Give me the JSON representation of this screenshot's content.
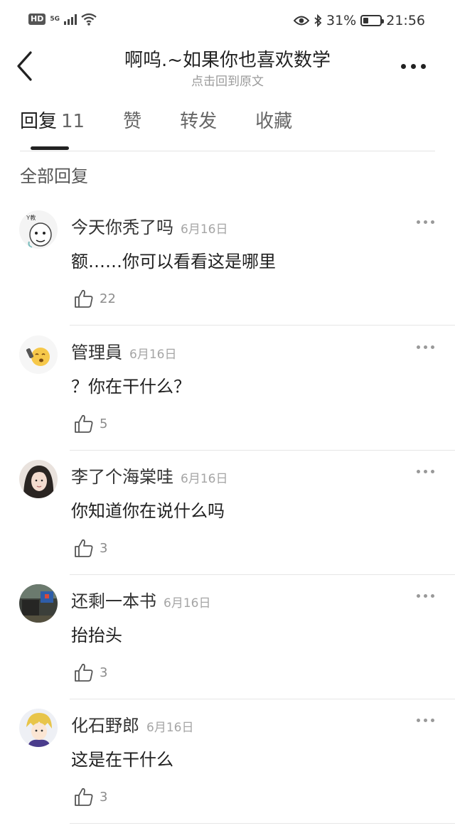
{
  "status_bar": {
    "hd": "HD",
    "network": "5G",
    "battery": "31%",
    "battery_level": 0.31,
    "time": "21:56"
  },
  "header": {
    "title": "啊呜.~如果你也喜欢数学",
    "subtitle": "点击回到原文"
  },
  "tabs": [
    {
      "label": "回复",
      "count": "11",
      "active": true
    },
    {
      "label": "赞"
    },
    {
      "label": "转发"
    },
    {
      "label": "收藏"
    }
  ],
  "section_title": "全部回复",
  "replies": [
    {
      "name": "今天你秃了吗",
      "date": "6月16日",
      "content": "额……你可以看看这是哪里",
      "likes": "22"
    },
    {
      "name": "管理員",
      "date": "6月16日",
      "content": "？你在干什么？",
      "likes": "5"
    },
    {
      "name": "李了个海棠哇",
      "date": "6月16日",
      "content": "你知道你在说什么吗",
      "likes": "3"
    },
    {
      "name": "还剩一本书",
      "date": "6月16日",
      "content": "抬抬头",
      "likes": "3"
    },
    {
      "name": "化石野郎",
      "date": "6月16日",
      "content": "这是在干什么",
      "likes": "3"
    }
  ],
  "colors": {
    "text_primary": "#1f1f1f",
    "text_secondary": "#9a9a9a",
    "divider": "#e6e6e6"
  }
}
